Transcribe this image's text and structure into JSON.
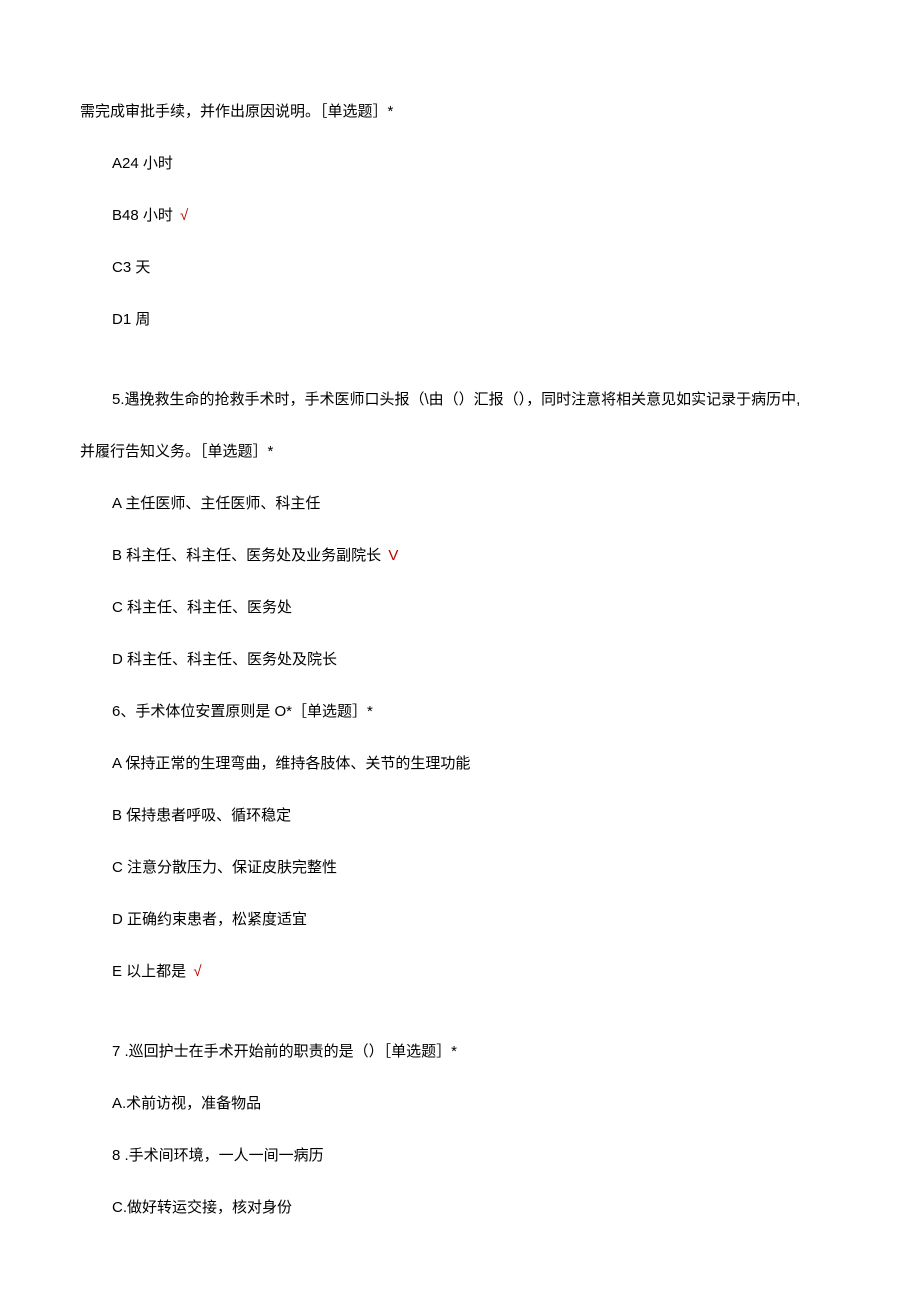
{
  "q4": {
    "continuation": "需完成审批手续，并作出原因说明。［单选题］*",
    "optA": "A24 小时",
    "optB": "B48 小时",
    "optB_check": "√",
    "optC": "C3 天",
    "optD": "D1 周"
  },
  "q5": {
    "stem_line1": "5.遇挽救生命的抢救手术时，手术医师口头报（\\由（）汇报（），同时注意将相关意见如实记录于病历中,",
    "stem_line2": "并履行告知义务。［单选题］*",
    "optA": "A 主任医师、主任医师、科主任",
    "optB": "B 科主任、科主任、医务处及业务副院长",
    "optB_check": "V",
    "optC": "C 科主任、科主任、医务处",
    "optD": "D 科主任、科主任、医务处及院长"
  },
  "q6": {
    "stem": "6、手术体位安置原则是 O*［单选题］*",
    "optA": "A 保持正常的生理弯曲，维持各肢体、关节的生理功能",
    "optB": "B 保持患者呼吸、循环稳定",
    "optC": "C 注意分散压力、保证皮肤完整性",
    "optD": "D 正确约束患者，松紧度适宜",
    "optE": "E 以上都是",
    "optE_check": "√"
  },
  "q7": {
    "stem": "7   .巡回护士在手术开始前的职责的是（）［单选题］*",
    "optA": "A.术前访视，准备物品",
    "opt8": "8   .手术间环境，一人一间一病历",
    "optC": "C.做好转运交接，核对身份"
  }
}
